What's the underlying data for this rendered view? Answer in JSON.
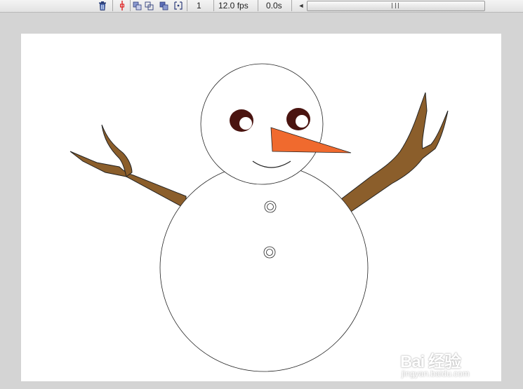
{
  "toolbar": {
    "icons": [
      "trash-icon",
      "center-frame-icon",
      "onion-skin-icon",
      "onion-skin-outlines-icon",
      "edit-multiple-frames-icon",
      "modify-onion-markers-icon"
    ],
    "current_frame": "1",
    "frame_rate": "12.0 fps",
    "elapsed_time": "0.0s"
  },
  "colors": {
    "background": "#d4d4d4",
    "stage": "#ffffff",
    "branch": "#8b5e2b",
    "nose": "#f06a2e",
    "eye": "#4a1410",
    "outline": "#222222"
  },
  "watermark": {
    "logo": "Bai 经验",
    "url": "jingyan.baidu.com"
  }
}
